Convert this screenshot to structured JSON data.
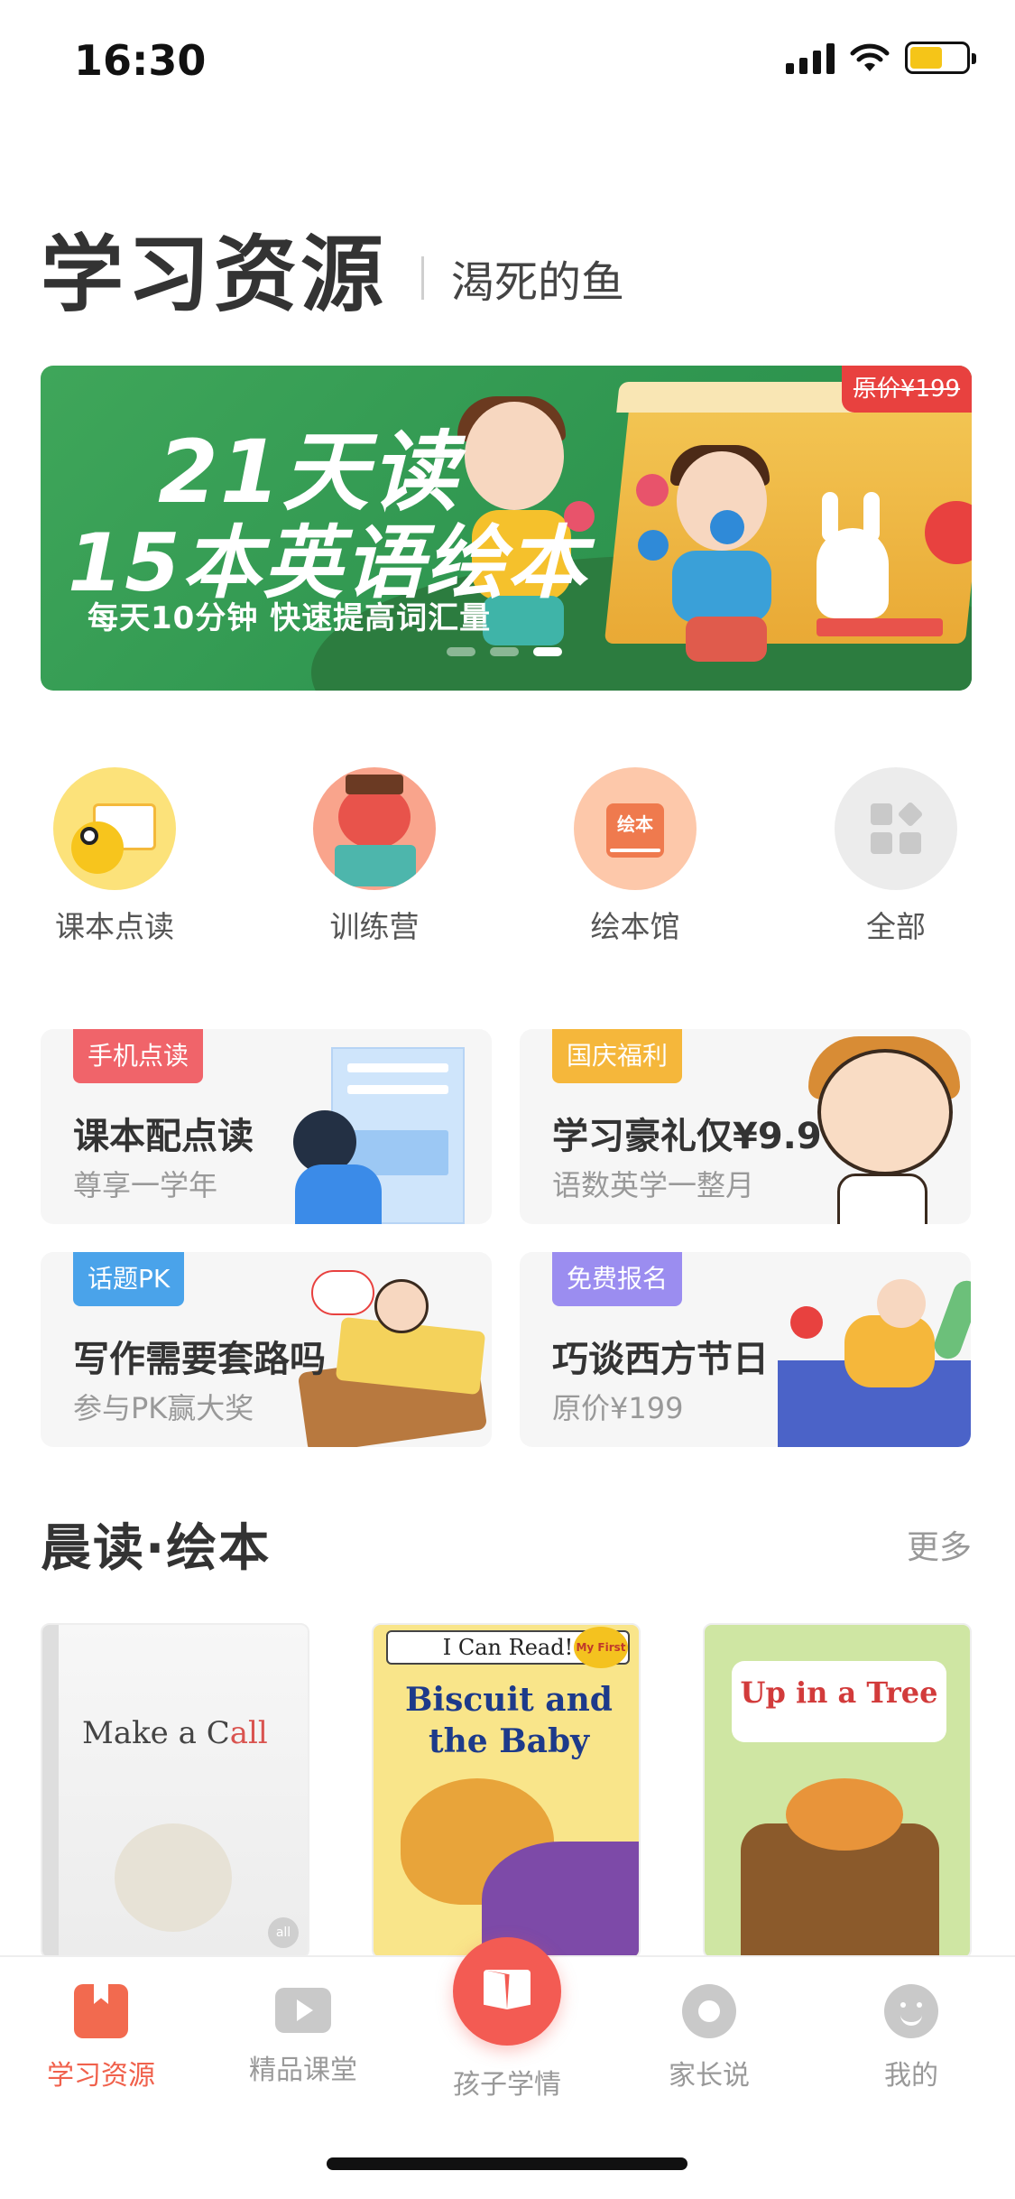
{
  "status_bar": {
    "time": "16:30"
  },
  "header": {
    "title": "学习资源",
    "subtitle": "渴死的鱼"
  },
  "banner": {
    "line1": "21天读",
    "line2": "15本英语绘本",
    "line3": "每天10分钟  快速提高词汇量",
    "price_tag": "原价¥199",
    "slides_total": 3,
    "active_slide": 3
  },
  "quick_links": [
    {
      "label": "课本点读",
      "icon": "textbook-reading-icon"
    },
    {
      "label": "训练营",
      "icon": "training-camp-icon"
    },
    {
      "label": "绘本馆",
      "icon": "picture-book-icon",
      "icon_text": "绘本"
    },
    {
      "label": "全部",
      "icon": "all-grid-icon"
    }
  ],
  "cards": [
    {
      "tag": "手机点读",
      "title": "课本配点读",
      "subtitle": "尊享一学年",
      "tag_color": "#f0646a"
    },
    {
      "tag": "国庆福利",
      "title": "学习豪礼仅¥9.9",
      "subtitle": "语数英学一整月",
      "tag_color": "#f5b73b"
    },
    {
      "tag": "话题PK",
      "title": "写作需要套路吗",
      "subtitle": "参与PK赢大奖",
      "tag_color": "#4aa3ea"
    },
    {
      "tag": "免费报名",
      "title": "巧谈西方节日",
      "subtitle": "原价¥199",
      "tag_color": "#9b8df0"
    }
  ],
  "section": {
    "title": "晨读·绘本",
    "more": "更多"
  },
  "books": [
    {
      "title_a": "Make a C",
      "title_b": "all",
      "badge": "all"
    },
    {
      "series": "I Can Read!",
      "title": "Biscuit and the Baby",
      "sticker": "My First"
    },
    {
      "title": "Up in a Tree"
    }
  ],
  "tabbar": [
    {
      "label": "学习资源",
      "icon": "bookmark-icon",
      "active": true
    },
    {
      "label": "精品课堂",
      "icon": "video-play-icon",
      "active": false
    },
    {
      "label": "孩子学情",
      "icon": "open-book-icon",
      "active": false
    },
    {
      "label": "家长说",
      "icon": "aperture-icon",
      "active": false
    },
    {
      "label": "我的",
      "icon": "smiley-icon",
      "active": false
    }
  ],
  "colors": {
    "accent": "#f0614c",
    "banner_green": "#3fa65a"
  }
}
